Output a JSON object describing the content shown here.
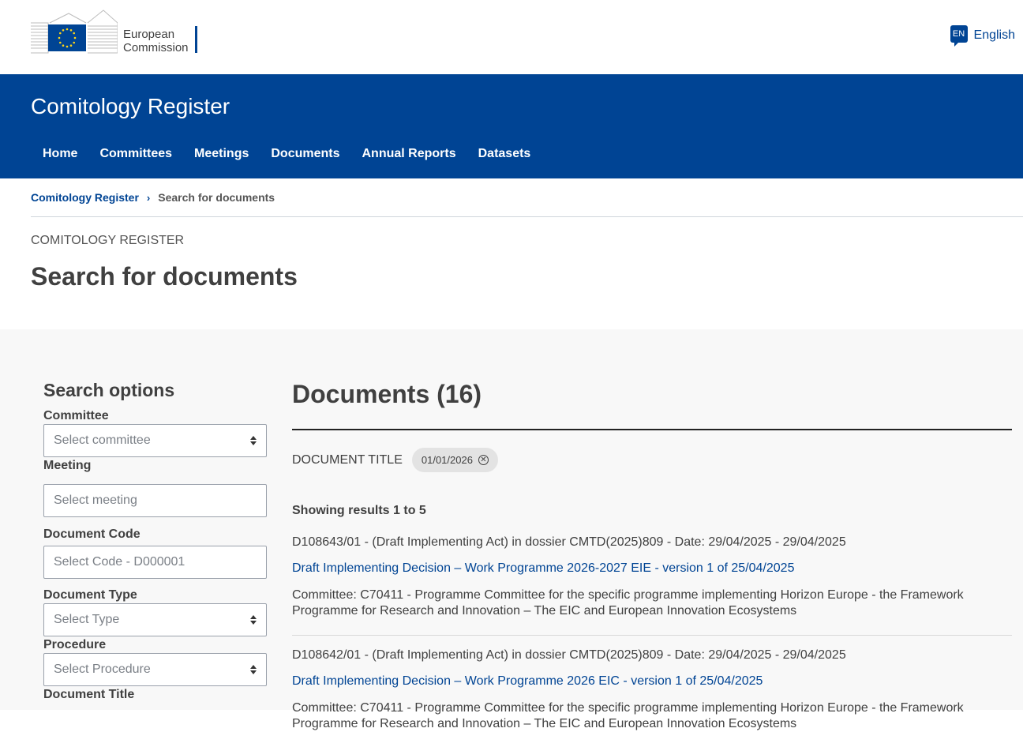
{
  "brand": {
    "name_line1": "European",
    "name_line2": "Commission",
    "eu_blue": "#004494",
    "star_color": "#ffd617"
  },
  "language": {
    "code": "EN",
    "label": "English"
  },
  "header": {
    "site_title": "Comitology Register",
    "nav": [
      "Home",
      "Committees",
      "Meetings",
      "Documents",
      "Annual Reports",
      "Datasets"
    ]
  },
  "breadcrumb": {
    "root": "Comitology Register",
    "current": "Search for documents"
  },
  "page": {
    "kicker": "COMITOLOGY REGISTER",
    "title": "Search for documents"
  },
  "sidebar": {
    "title": "Search options",
    "fields": [
      {
        "label": "Committee",
        "placeholder": "Select committee",
        "type": "select"
      },
      {
        "label": "Meeting",
        "placeholder": "Select meeting",
        "type": "text"
      },
      {
        "label": "Document Code",
        "placeholder": "Select Code - D000001",
        "type": "text"
      },
      {
        "label": "Document Type",
        "placeholder": "Select Type",
        "type": "select"
      },
      {
        "label": "Procedure",
        "placeholder": "Select Procedure",
        "type": "select"
      },
      {
        "label": "Document Title"
      }
    ]
  },
  "results": {
    "heading": "Documents (16)",
    "filter_label": "DOCUMENT TITLE",
    "filter_chip": "01/01/2026",
    "showing": "Showing results 1 to 5",
    "items": [
      {
        "meta": "D108643/01 - (Draft Implementing Act) in dossier CMTD(2025)809 - Date: 29/04/2025 - 29/04/2025",
        "title": "Draft Implementing Decision – Work Programme 2026-2027 EIE - version 1 of 25/04/2025",
        "committee": "Committee: C70411 - Programme Committee for the specific programme implementing Horizon Europe - the Framework Programme for Research and Innovation – The EIC and European Innovation Ecosystems"
      },
      {
        "meta": "D108642/01 - (Draft Implementing Act) in dossier CMTD(2025)809 - Date: 29/04/2025 - 29/04/2025",
        "title": "Draft Implementing Decision – Work Programme 2026 EIC - version 1 of 25/04/2025",
        "committee": "Committee: C70411 - Programme Committee for the specific programme implementing Horizon Europe - the Framework Programme for Research and Innovation – The EIC and European Innovation Ecosystems"
      }
    ]
  }
}
